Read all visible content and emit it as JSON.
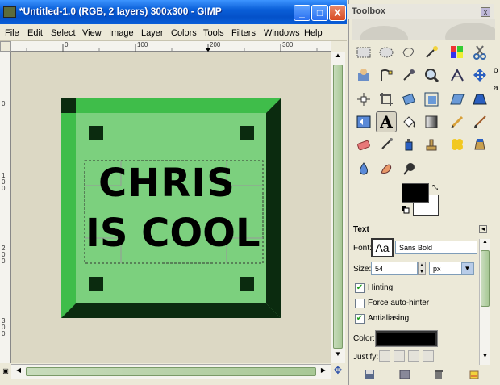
{
  "window": {
    "title": "*Untitled-1.0 (RGB, 2 layers) 300x300 - GIMP",
    "min_label": "_",
    "max_label": "□",
    "close_label": "X"
  },
  "menu": [
    "File",
    "Edit",
    "Select",
    "View",
    "Image",
    "Layer",
    "Colors",
    "Tools",
    "Filters",
    "Windows",
    "Help"
  ],
  "ruler": {
    "h_ticks": [
      "0",
      "100",
      "200",
      "300"
    ],
    "v_ticks": [
      "0",
      "1 0 0",
      "2 0 0",
      "3 0 0"
    ]
  },
  "canvas": {
    "text_line1": "CHRIS",
    "text_line2": "IS COOL",
    "image_bg_color": "#7cd07e",
    "border_dark": "#0b2b0f",
    "border_light": "#3fbd4a"
  },
  "toolbox": {
    "title": "Toolbox",
    "close_label": "x"
  },
  "text_options": {
    "title": "Text",
    "font_label": "Font:",
    "font_preview": "Aa",
    "font_value": "Sans Bold",
    "size_label": "Size:",
    "size_value": "54",
    "unit_value": "px",
    "hinting_label": "Hinting",
    "hinting_checked": true,
    "force_label": "Force auto-hinter",
    "force_checked": false,
    "antialias_label": "Antialiasing",
    "antialias_checked": true,
    "color_label": "Color:",
    "text_color": "#000000",
    "justify_label": "Justify:"
  },
  "side_crop": {
    "char1": "o",
    "char2": "a"
  }
}
